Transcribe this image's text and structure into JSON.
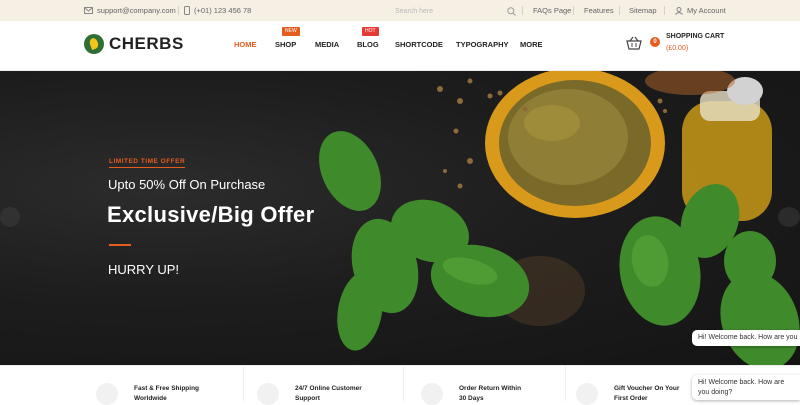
{
  "topbar": {
    "email": "support@company.com",
    "phone": "(+01) 123 456 78",
    "search_placeholder": "Search here",
    "links": [
      "FAQs Page",
      "Features",
      "Sitemap"
    ],
    "account": "My Account"
  },
  "header": {
    "brand": "CHERBS",
    "nav": [
      {
        "label": "HOME",
        "active": true
      },
      {
        "label": "SHOP",
        "badge": "NEW"
      },
      {
        "label": "MEDIA"
      },
      {
        "label": "BLOG",
        "badge": "HOT"
      },
      {
        "label": "SHORTCODE"
      },
      {
        "label": "TYPOGRAPHY"
      },
      {
        "label": "MORE"
      }
    ],
    "cart": {
      "count": "0",
      "label": "SHOPPING CART",
      "amount": "(£0.00)"
    }
  },
  "hero": {
    "tag": "LIMITED TIME OFFER",
    "subtitle": "Upto 50% Off On Purchase",
    "title": "Exclusive/Big Offer",
    "cta": "HURRY UP!"
  },
  "features": [
    {
      "line1": "Fast & Free Shipping",
      "line2": "Worldwide"
    },
    {
      "line1": "24/7 Online Customer",
      "line2": "Support"
    },
    {
      "line1": "Order Return Within",
      "line2": "30 Days"
    },
    {
      "line1": "Gift Voucher On Your",
      "line2": "First Order"
    }
  ],
  "chat": {
    "bubble1": "Hi! Welcome back. How are you",
    "bubble2": "Hi! Welcome back. How are you doing?"
  },
  "colors": {
    "accent": "#e55c1f",
    "topbar_bg": "#f5efe4",
    "hero_bg": "#1d1d1d"
  }
}
